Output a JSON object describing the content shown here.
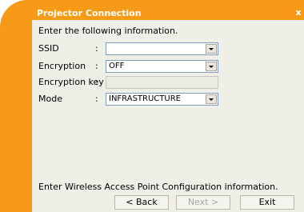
{
  "window": {
    "title": "Projector Connection",
    "close_label": "x"
  },
  "instruction": "Enter the following information.",
  "fields": {
    "ssid": {
      "label": "SSID",
      "colon": ":",
      "value": ""
    },
    "encryption": {
      "label": "Encryption",
      "colon": ":",
      "value": "OFF"
    },
    "encryption_key": {
      "label": "Encryption key",
      "colon": ":",
      "value": ""
    },
    "mode": {
      "label": "Mode",
      "colon": ":",
      "value": "INFRASTRUCTURE"
    }
  },
  "footer_text": "Enter Wireless Access Point Configuration information.",
  "buttons": {
    "back": "< Back",
    "next": "Next >",
    "exit": "Exit"
  },
  "colors": {
    "frame": "#f79a18",
    "dialog": "#efefe8",
    "title_text": "#ffffff"
  }
}
